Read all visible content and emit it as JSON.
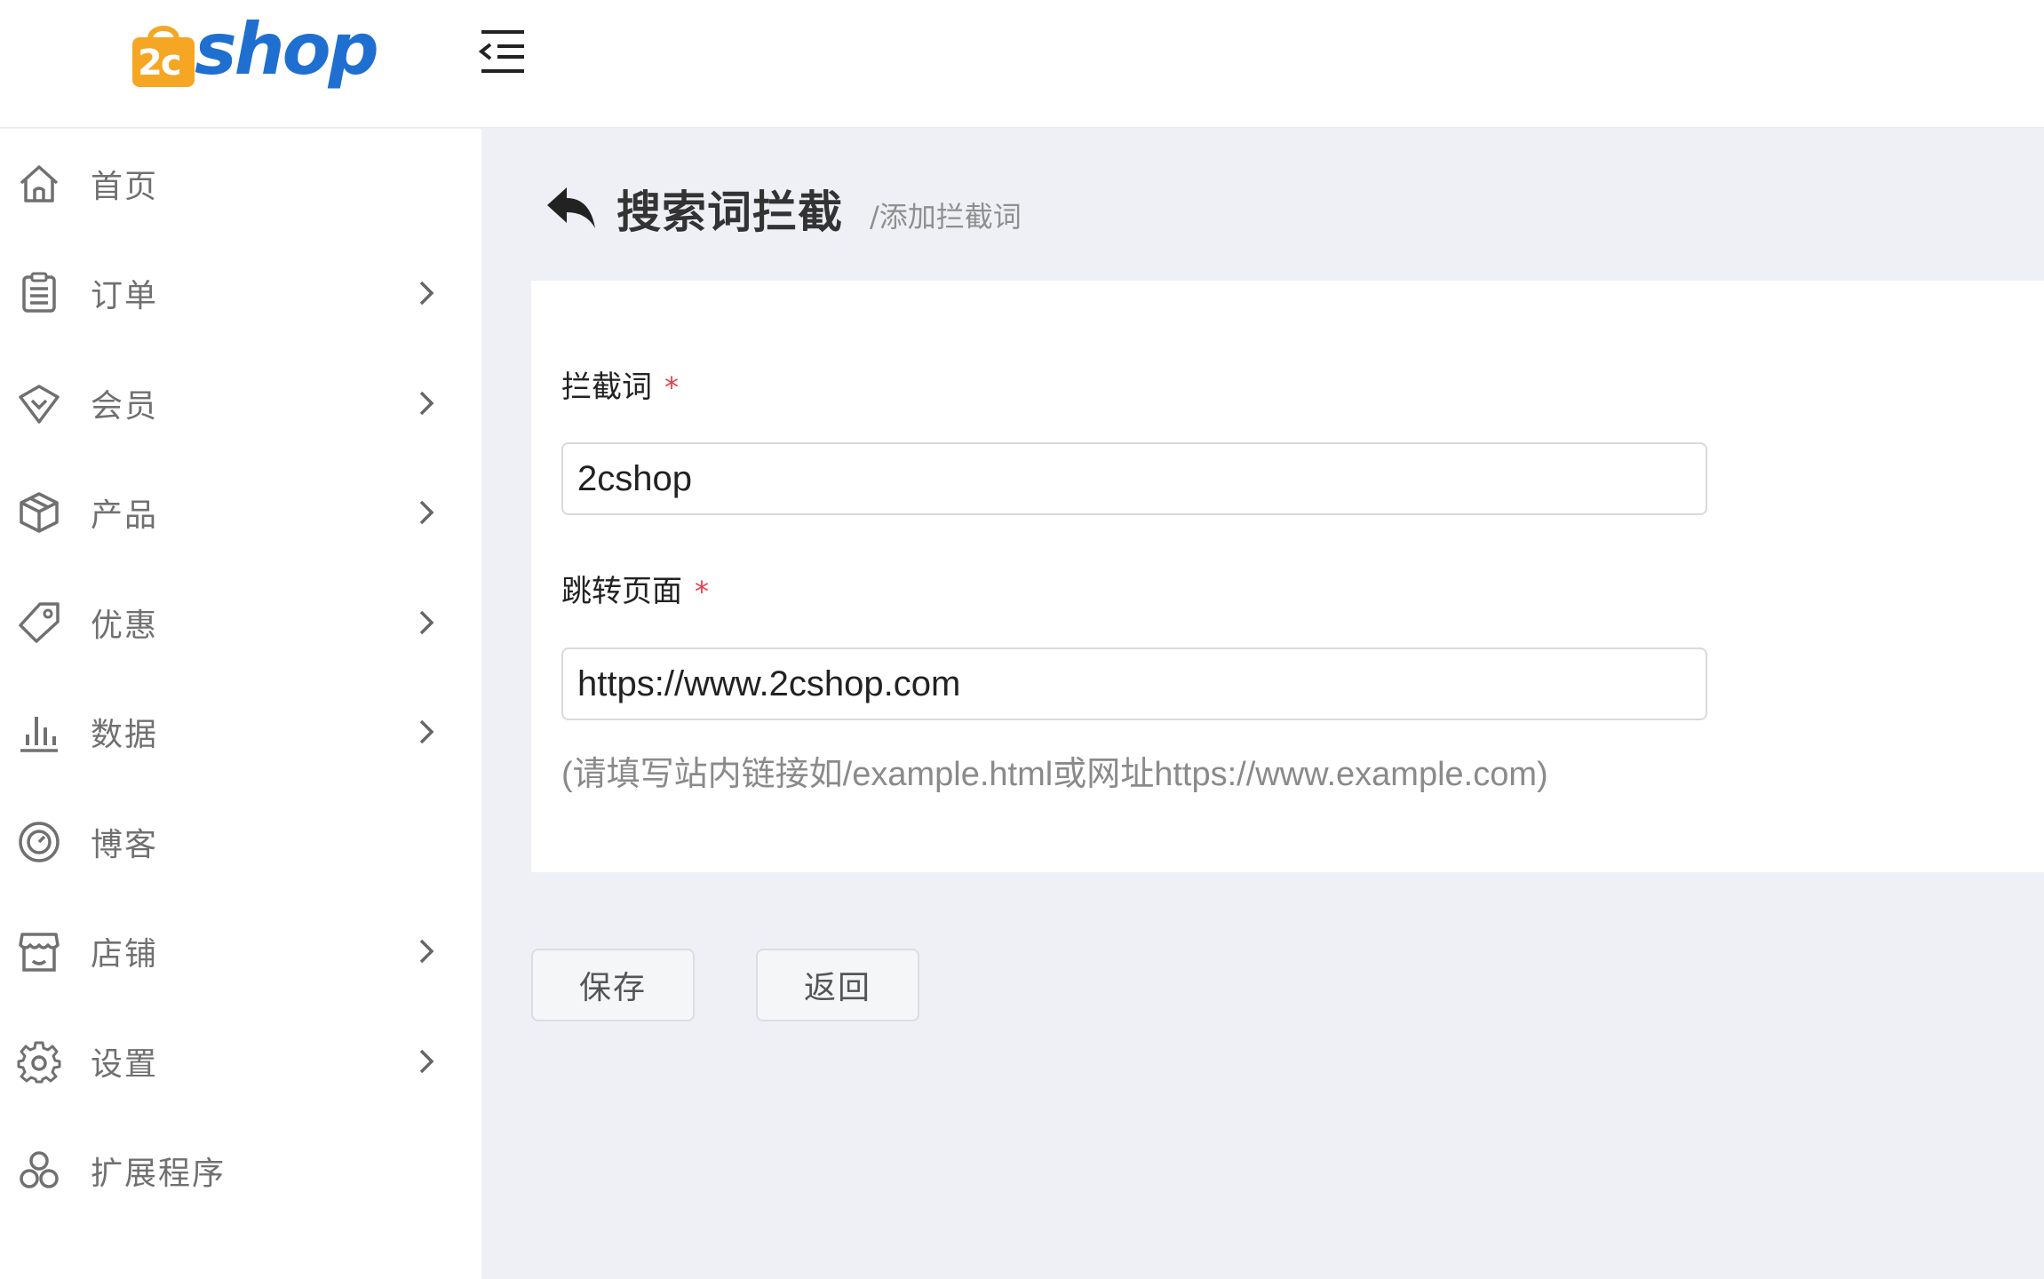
{
  "brand": {
    "logo_text": "shop",
    "logo_badge_text": "2c"
  },
  "header": {
    "menu_toggle_icon": "indent-menu-icon"
  },
  "sidebar": {
    "items": [
      {
        "label": "首页",
        "icon": "home-icon",
        "has_submenu": false
      },
      {
        "label": "订单",
        "icon": "clipboard-list-icon",
        "has_submenu": true
      },
      {
        "label": "会员",
        "icon": "heart-shield-icon",
        "has_submenu": true
      },
      {
        "label": "产品",
        "icon": "box-icon",
        "has_submenu": true
      },
      {
        "label": "优惠",
        "icon": "tag-icon",
        "has_submenu": true
      },
      {
        "label": "数据",
        "icon": "bar-chart-icon",
        "has_submenu": true
      },
      {
        "label": "博客",
        "icon": "target-icon",
        "has_submenu": false
      },
      {
        "label": "店铺",
        "icon": "store-icon",
        "has_submenu": true
      },
      {
        "label": "设置",
        "icon": "gear-icon",
        "has_submenu": true
      },
      {
        "label": "扩展程序",
        "icon": "extensions-icon",
        "has_submenu": false
      }
    ]
  },
  "page": {
    "title": "搜索词拦截",
    "subtitle": "/添加拦截词"
  },
  "form": {
    "keyword": {
      "label": "拦截词",
      "required_mark": "*",
      "value": "2cshop"
    },
    "redirect": {
      "label": "跳转页面",
      "required_mark": "*",
      "value": "https://www.2cshop.com",
      "help": "(请填写站内链接如/example.html或网址https://www.example.com)"
    }
  },
  "actions": {
    "save_label": "保存",
    "back_label": "返回"
  },
  "colors": {
    "brand_orange": "#f5a623",
    "brand_blue": "#1f6fd1",
    "required_red": "#e8404a",
    "background": "#eff0f5"
  }
}
